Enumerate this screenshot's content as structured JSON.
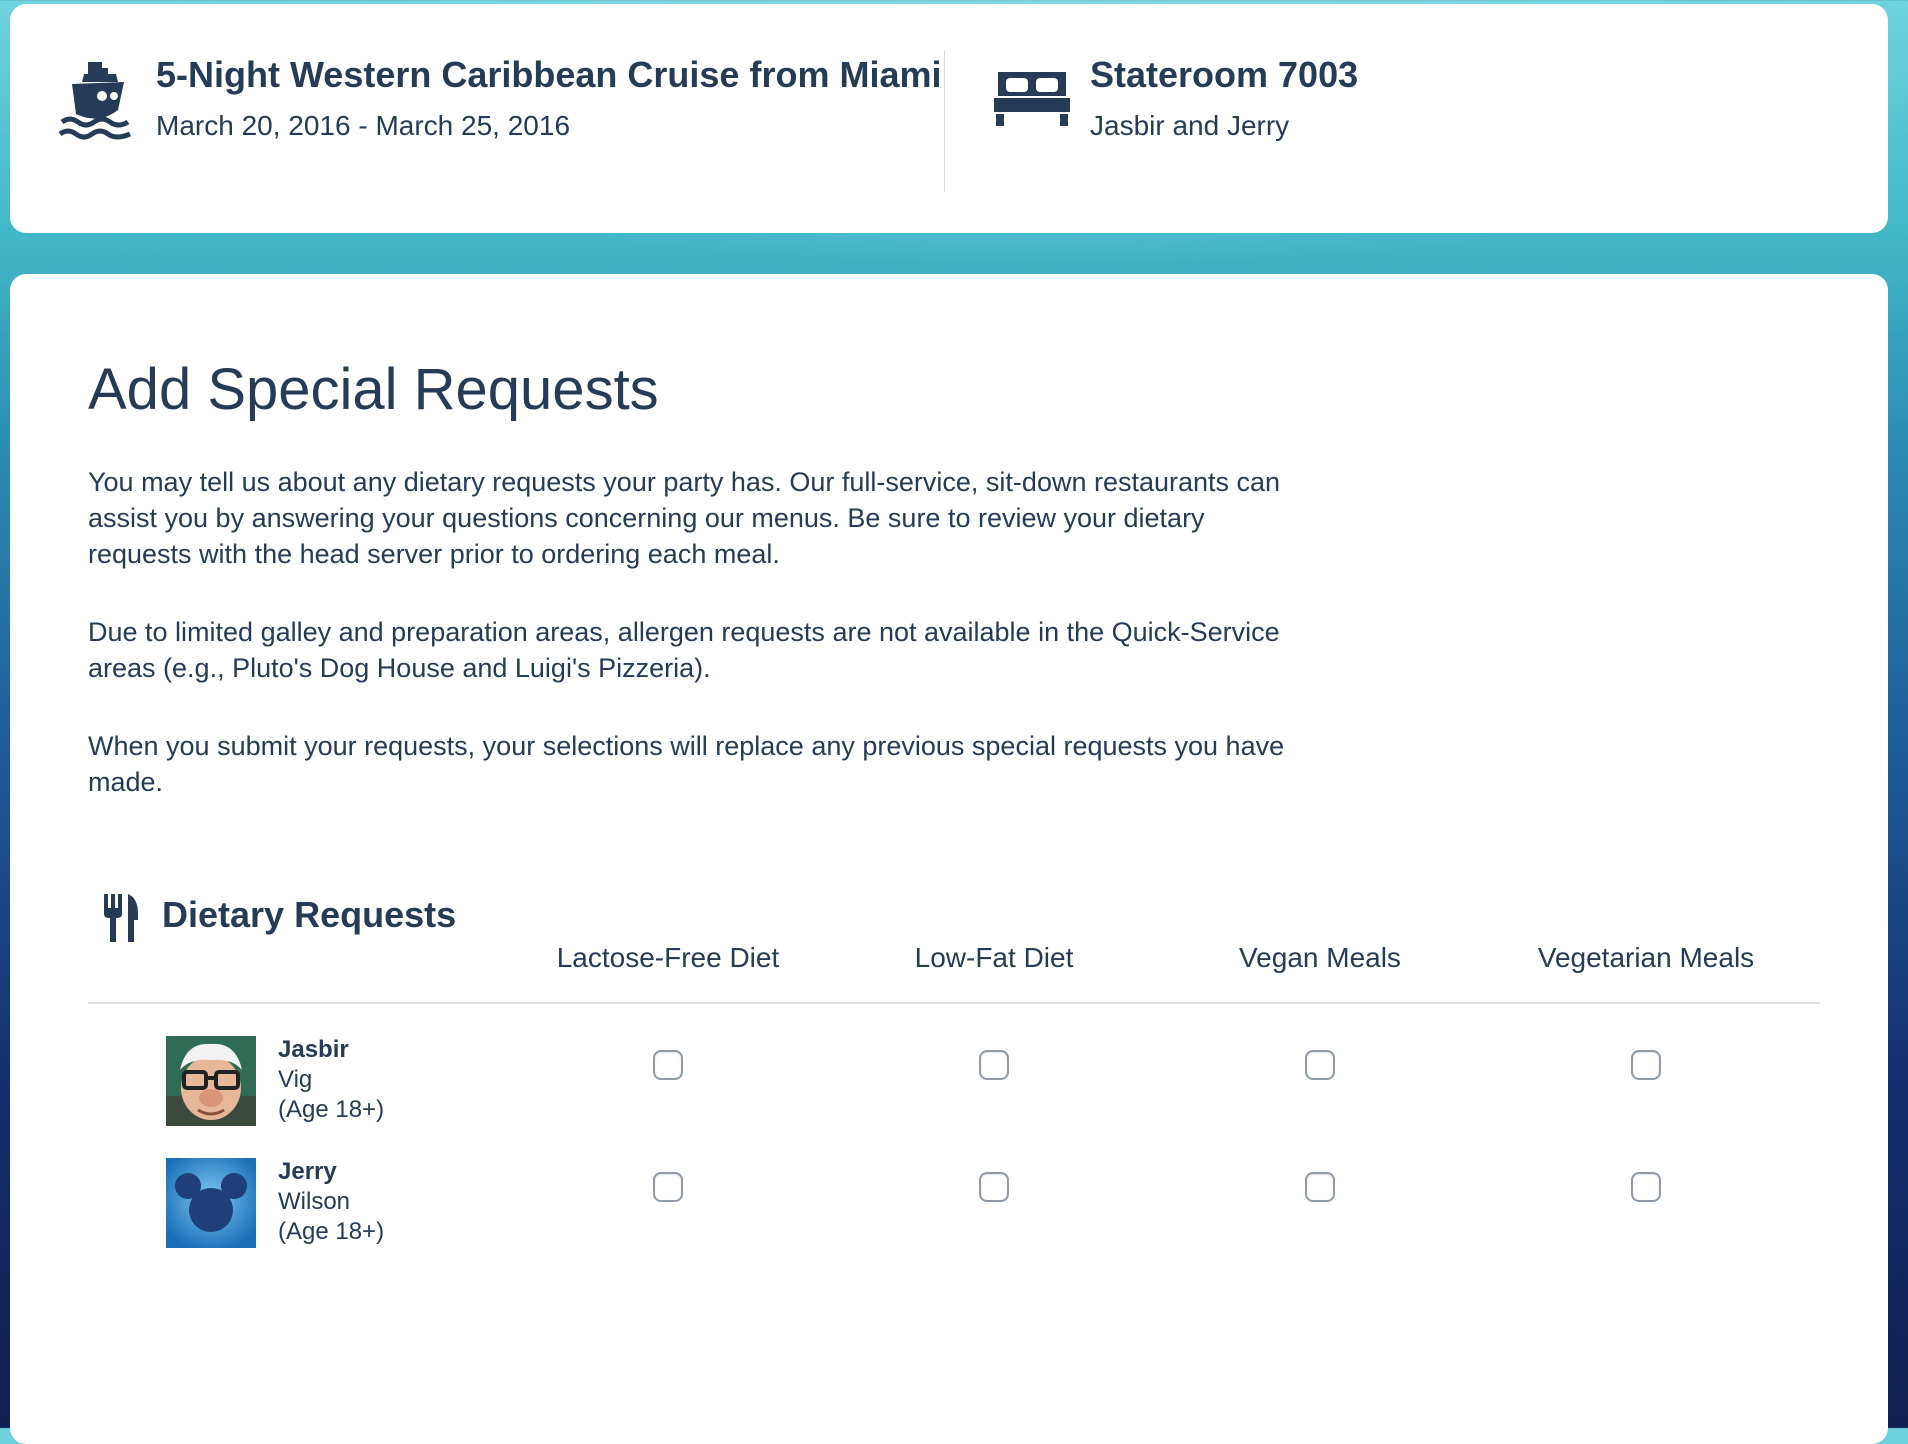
{
  "reservation": {
    "cruise_title": "5-Night Western Caribbean Cruise from Miami",
    "cruise_dates": "March 20, 2016 - March 25, 2016",
    "ship_icon": "cruise-ship-icon",
    "stateroom_title": "Stateroom 7003",
    "stateroom_guests": "Jasbir and Jerry",
    "bed_icon": "bed-icon"
  },
  "page": {
    "title": "Add Special Requests",
    "paragraphs": [
      "You may tell us about any dietary requests your party has. Our full-service, sit-down restaurants can assist you by answering your questions concerning our menus. Be sure to review your dietary requests with the head server prior to ordering each meal.",
      "Due to limited galley and preparation areas, allergen requests are not available in the Quick-Service areas (e.g., Pluto's Dog House and Luigi's Pizzeria).",
      "When you submit your requests, your selections will replace any previous special requests you have made."
    ]
  },
  "dietary": {
    "section_title": "Dietary Requests",
    "section_icon": "fork-knife-icon",
    "columns": [
      "Lactose-Free Diet",
      "Low-Fat Diet",
      "Vegan Meals",
      "Vegetarian Meals"
    ],
    "guests": [
      {
        "first_name": "Jasbir",
        "last_name": "Vig",
        "age": "(Age 18+)",
        "selections": [
          false,
          false,
          false,
          false
        ]
      },
      {
        "first_name": "Jerry",
        "last_name": "Wilson",
        "age": "(Age 18+)",
        "selections": [
          false,
          false,
          false,
          false
        ]
      }
    ]
  },
  "colors": {
    "text": "#253b56",
    "card": "#ffffff",
    "background_top": "#6ed3dd",
    "background_bottom": "#101f52"
  }
}
